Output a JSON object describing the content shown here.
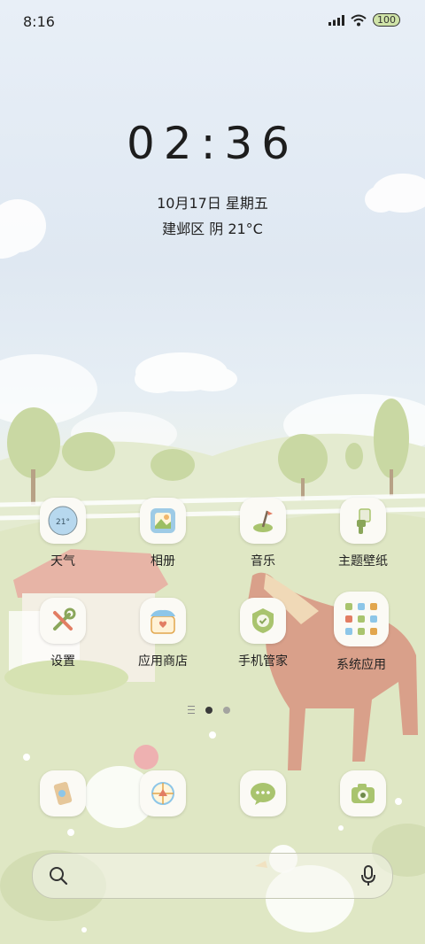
{
  "status_bar": {
    "time": "8:16",
    "battery": "100"
  },
  "lock": {
    "clock": "02:36",
    "date": "10月17日 星期五",
    "weather": "建邺区 阴 21°C"
  },
  "weather_icon_text": "21°",
  "apps": [
    {
      "label": "天气",
      "icon": "weather-icon"
    },
    {
      "label": "相册",
      "icon": "gallery-icon"
    },
    {
      "label": "音乐",
      "icon": "music-icon"
    },
    {
      "label": "主题壁纸",
      "icon": "theme-icon"
    },
    {
      "label": "设置",
      "icon": "settings-icon"
    },
    {
      "label": "应用商店",
      "icon": "app-store-icon"
    },
    {
      "label": "手机管家",
      "icon": "phone-manager-icon"
    },
    {
      "label": "系统应用",
      "icon": "system-apps-folder-icon"
    }
  ],
  "dock": [
    {
      "icon": "phone-icon"
    },
    {
      "icon": "browser-icon"
    },
    {
      "icon": "messages-icon"
    },
    {
      "icon": "camera-icon"
    }
  ],
  "search": {
    "placeholder": ""
  },
  "colors": {
    "sky": "#e8eff7",
    "meadow": "#dfe7c8",
    "icon_bg": "#fbfaf5",
    "accent_green": "#8aa65a"
  }
}
